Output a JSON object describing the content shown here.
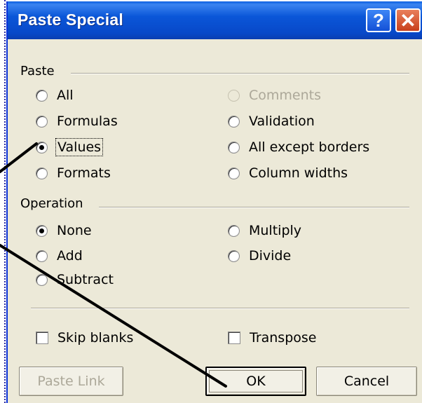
{
  "window": {
    "title": "Paste Special",
    "help_button": "?",
    "close_button": "✕"
  },
  "paste_group": {
    "label": "Paste",
    "options": [
      {
        "label": "All",
        "checked": false,
        "disabled": false
      },
      {
        "label": "Formulas",
        "checked": false,
        "disabled": false
      },
      {
        "label": "Values",
        "checked": true,
        "disabled": false
      },
      {
        "label": "Formats",
        "checked": false,
        "disabled": false
      },
      {
        "label": "Comments",
        "checked": false,
        "disabled": true
      },
      {
        "label": "Validation",
        "checked": false,
        "disabled": false
      },
      {
        "label": "All except borders",
        "checked": false,
        "disabled": false
      },
      {
        "label": "Column widths",
        "checked": false,
        "disabled": false
      }
    ]
  },
  "operation_group": {
    "label": "Operation",
    "options": [
      {
        "label": "None",
        "checked": true
      },
      {
        "label": "Add",
        "checked": false
      },
      {
        "label": "Subtract",
        "checked": false
      },
      {
        "label": "Multiply",
        "checked": false
      },
      {
        "label": "Divide",
        "checked": false
      }
    ]
  },
  "checkboxes": {
    "skip_blanks": {
      "label": "Skip blanks",
      "checked": false
    },
    "transpose": {
      "label": "Transpose",
      "checked": false
    }
  },
  "buttons": {
    "paste_link": {
      "label": "Paste Link",
      "disabled": true
    },
    "ok": {
      "label": "OK",
      "default": true
    },
    "cancel": {
      "label": "Cancel"
    }
  },
  "colors": {
    "titlebar": "#0a56d8",
    "dialog_bg": "#ece9d8",
    "disabled_text": "#aca899",
    "close_button": "#c8401c"
  }
}
